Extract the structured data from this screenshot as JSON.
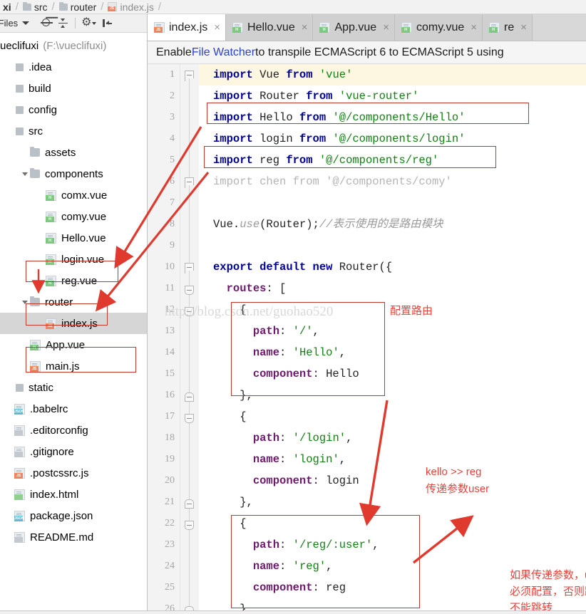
{
  "breadcrumb": {
    "items": [
      {
        "label": "xi",
        "icon": "none",
        "bold": true
      },
      {
        "label": "src",
        "icon": "folder-icon"
      },
      {
        "label": "router",
        "icon": "folder-icon"
      },
      {
        "label": "index.js",
        "icon": "js-file-icon",
        "dim": true
      }
    ]
  },
  "project_toolbar": {
    "title": "ct Files",
    "icons": [
      "locate-icon",
      "collapse-all-icon",
      "settings-gear-icon",
      "hide-panel-icon"
    ]
  },
  "tree": {
    "root": {
      "name": "ueclifuxi",
      "path": "(F:\\vueclifuxi)"
    },
    "items": [
      {
        "label": ".idea",
        "indent": 0,
        "icon": "square-folder-icon",
        "type": "sq"
      },
      {
        "label": "build",
        "indent": 0,
        "icon": "square-folder-icon",
        "type": "sq"
      },
      {
        "label": "config",
        "indent": 0,
        "icon": "square-folder-icon",
        "type": "sq"
      },
      {
        "label": "src",
        "indent": 0,
        "icon": "square-folder-icon",
        "type": "sq"
      },
      {
        "label": "assets",
        "indent": 1,
        "icon": "folder-icon",
        "type": "folder"
      },
      {
        "label": "components",
        "indent": 1,
        "icon": "folder-icon",
        "type": "folder",
        "twisty": true
      },
      {
        "label": "comx.vue",
        "indent": 2,
        "icon": "vue-file-icon",
        "type": "file",
        "tag": "H"
      },
      {
        "label": "comy.vue",
        "indent": 2,
        "icon": "vue-file-icon",
        "type": "file",
        "tag": "H"
      },
      {
        "label": "Hello.vue",
        "indent": 2,
        "icon": "vue-file-icon",
        "type": "file",
        "tag": "H"
      },
      {
        "label": "login.vue",
        "indent": 2,
        "icon": "vue-file-icon",
        "type": "file",
        "tag": "H"
      },
      {
        "label": "reg.vue",
        "indent": 2,
        "icon": "vue-file-icon",
        "type": "file",
        "tag": "H"
      },
      {
        "label": "router",
        "indent": 1,
        "icon": "folder-icon",
        "type": "folder",
        "twisty": true
      },
      {
        "label": "index.js",
        "indent": 2,
        "icon": "js-file-icon",
        "type": "file",
        "tag": "JS",
        "selected": true
      },
      {
        "label": "App.vue",
        "indent": 1,
        "icon": "vue-file-icon",
        "type": "file",
        "tag": "H"
      },
      {
        "label": "main.js",
        "indent": 1,
        "icon": "js-file-icon",
        "type": "file",
        "tag": "JS"
      },
      {
        "label": "static",
        "indent": 0,
        "icon": "square-folder-icon",
        "type": "sq"
      },
      {
        "label": ".babelrc",
        "indent": 0,
        "icon": "json-file-icon",
        "type": "file",
        "tag": "JSON"
      },
      {
        "label": ".editorconfig",
        "indent": 0,
        "icon": "text-file-icon",
        "type": "file",
        "tag": ""
      },
      {
        "label": ".gitignore",
        "indent": 0,
        "icon": "text-file-icon",
        "type": "file",
        "tag": ""
      },
      {
        "label": ".postcssrc.js",
        "indent": 0,
        "icon": "js-file-icon",
        "type": "file",
        "tag": "JS"
      },
      {
        "label": "index.html",
        "indent": 0,
        "icon": "html-file-icon",
        "type": "file",
        "tag": "HTML"
      },
      {
        "label": "package.json",
        "indent": 0,
        "icon": "json-file-icon",
        "type": "file",
        "tag": "JSON"
      },
      {
        "label": "README.md",
        "indent": 0,
        "icon": "text-file-icon",
        "type": "file",
        "tag": ""
      }
    ]
  },
  "tabs": [
    {
      "label": "index.js",
      "icon": "js-file-icon",
      "tag": "JS",
      "active": true
    },
    {
      "label": "Hello.vue",
      "icon": "vue-file-icon",
      "tag": "H",
      "active": false
    },
    {
      "label": "App.vue",
      "icon": "vue-file-icon",
      "tag": "H",
      "active": false
    },
    {
      "label": "comy.vue",
      "icon": "vue-file-icon",
      "tag": "H",
      "active": false
    },
    {
      "label": "re",
      "icon": "vue-file-icon",
      "tag": "H",
      "active": false
    }
  ],
  "notification": {
    "prefix": "Enable ",
    "link": "File Watcher",
    "suffix": " to transpile ECMAScript 6 to ECMAScript 5 using"
  },
  "code": {
    "lines": [
      {
        "n": 1,
        "segments": [
          {
            "t": "import",
            "c": "kw"
          },
          {
            "t": " Vue ",
            "c": "id"
          },
          {
            "t": "from",
            "c": "kw"
          },
          {
            "t": " ",
            "c": "id"
          },
          {
            "t": "'vue'",
            "c": "str"
          }
        ]
      },
      {
        "n": 2,
        "segments": [
          {
            "t": "import",
            "c": "kw"
          },
          {
            "t": " Router ",
            "c": "id"
          },
          {
            "t": "from",
            "c": "kw"
          },
          {
            "t": " ",
            "c": "id"
          },
          {
            "t": "'vue-router'",
            "c": "str"
          }
        ]
      },
      {
        "n": 3,
        "segments": [
          {
            "t": "import",
            "c": "kw"
          },
          {
            "t": " Hello ",
            "c": "id"
          },
          {
            "t": "from",
            "c": "kw"
          },
          {
            "t": " ",
            "c": "id"
          },
          {
            "t": "'@/components/Hello'",
            "c": "str"
          }
        ]
      },
      {
        "n": 4,
        "segments": [
          {
            "t": "import",
            "c": "kw"
          },
          {
            "t": " login ",
            "c": "id"
          },
          {
            "t": "from",
            "c": "kw"
          },
          {
            "t": " ",
            "c": "id"
          },
          {
            "t": "'@/components/login'",
            "c": "str"
          }
        ]
      },
      {
        "n": 5,
        "segments": [
          {
            "t": "import",
            "c": "kw"
          },
          {
            "t": " reg ",
            "c": "id"
          },
          {
            "t": "from",
            "c": "kw"
          },
          {
            "t": " ",
            "c": "id"
          },
          {
            "t": "'@/components/reg'",
            "c": "str"
          }
        ]
      },
      {
        "n": 6,
        "segments": [
          {
            "t": "import chen from '@/components/comy'",
            "c": "ghost"
          }
        ]
      },
      {
        "n": 7,
        "segments": []
      },
      {
        "n": 8,
        "segments": [
          {
            "t": "Vue.",
            "c": "id"
          },
          {
            "t": "use",
            "c": "cmt"
          },
          {
            "t": "(Router);",
            "c": "id"
          },
          {
            "t": "//表示使用的是路由模块",
            "c": "cmt"
          }
        ]
      },
      {
        "n": 9,
        "segments": []
      },
      {
        "n": 10,
        "segments": [
          {
            "t": "export default new",
            "c": "kw"
          },
          {
            "t": " Router({",
            "c": "id"
          }
        ]
      },
      {
        "n": 11,
        "segments": [
          {
            "t": "  ",
            "c": "id"
          },
          {
            "t": "routes",
            "c": "prop"
          },
          {
            "t": ": [",
            "c": "id"
          }
        ]
      },
      {
        "n": 12,
        "segments": [
          {
            "t": "    {",
            "c": "id"
          }
        ]
      },
      {
        "n": 13,
        "segments": [
          {
            "t": "      ",
            "c": "id"
          },
          {
            "t": "path",
            "c": "prop"
          },
          {
            "t": ": ",
            "c": "id"
          },
          {
            "t": "'/'",
            "c": "str"
          },
          {
            "t": ",",
            "c": "id"
          }
        ]
      },
      {
        "n": 14,
        "segments": [
          {
            "t": "      ",
            "c": "id"
          },
          {
            "t": "name",
            "c": "prop"
          },
          {
            "t": ": ",
            "c": "id"
          },
          {
            "t": "'Hello'",
            "c": "str"
          },
          {
            "t": ",",
            "c": "id"
          }
        ]
      },
      {
        "n": 15,
        "segments": [
          {
            "t": "      ",
            "c": "id"
          },
          {
            "t": "component",
            "c": "prop"
          },
          {
            "t": ": Hello",
            "c": "id"
          }
        ]
      },
      {
        "n": 16,
        "segments": [
          {
            "t": "    },",
            "c": "id"
          }
        ]
      },
      {
        "n": 17,
        "segments": [
          {
            "t": "    {",
            "c": "id"
          }
        ]
      },
      {
        "n": 18,
        "segments": [
          {
            "t": "      ",
            "c": "id"
          },
          {
            "t": "path",
            "c": "prop"
          },
          {
            "t": ": ",
            "c": "id"
          },
          {
            "t": "'/login'",
            "c": "str"
          },
          {
            "t": ",",
            "c": "id"
          }
        ]
      },
      {
        "n": 19,
        "segments": [
          {
            "t": "      ",
            "c": "id"
          },
          {
            "t": "name",
            "c": "prop"
          },
          {
            "t": ": ",
            "c": "id"
          },
          {
            "t": "'login'",
            "c": "str"
          },
          {
            "t": ",",
            "c": "id"
          }
        ]
      },
      {
        "n": 20,
        "segments": [
          {
            "t": "      ",
            "c": "id"
          },
          {
            "t": "component",
            "c": "prop"
          },
          {
            "t": ": login",
            "c": "id"
          }
        ]
      },
      {
        "n": 21,
        "segments": [
          {
            "t": "    },",
            "c": "id"
          }
        ]
      },
      {
        "n": 22,
        "segments": [
          {
            "t": "    {",
            "c": "id"
          }
        ]
      },
      {
        "n": 23,
        "segments": [
          {
            "t": "      ",
            "c": "id"
          },
          {
            "t": "path",
            "c": "prop"
          },
          {
            "t": ": ",
            "c": "id"
          },
          {
            "t": "'/reg/:user'",
            "c": "str"
          },
          {
            "t": ",",
            "c": "id"
          }
        ]
      },
      {
        "n": 24,
        "segments": [
          {
            "t": "      ",
            "c": "id"
          },
          {
            "t": "name",
            "c": "prop"
          },
          {
            "t": ": ",
            "c": "id"
          },
          {
            "t": "'reg'",
            "c": "str"
          },
          {
            "t": ",",
            "c": "id"
          }
        ]
      },
      {
        "n": 25,
        "segments": [
          {
            "t": "      ",
            "c": "id"
          },
          {
            "t": "component",
            "c": "prop"
          },
          {
            "t": ": reg",
            "c": "id"
          }
        ]
      },
      {
        "n": 26,
        "segments": [
          {
            "t": "    }",
            "c": "id"
          }
        ]
      }
    ]
  },
  "annotations": {
    "config_route": "配置路由",
    "kello_reg": "kello >> reg",
    "pass_param_user": "传递参数user",
    "param_note_line1": "如果传递参数，user",
    "param_note_line2": "必须配置，否则路由",
    "param_note_line3": "不能跳转"
  },
  "watermark": "http://blog.csdn.net/guohao520",
  "colors": {
    "annotation_red": "#e8423a",
    "box_red": "#c0392b",
    "keyword": "#00009a",
    "string": "#128012",
    "property": "#6f1a6f",
    "link": "#2b43c8",
    "current_line": "#fdf7e2"
  }
}
